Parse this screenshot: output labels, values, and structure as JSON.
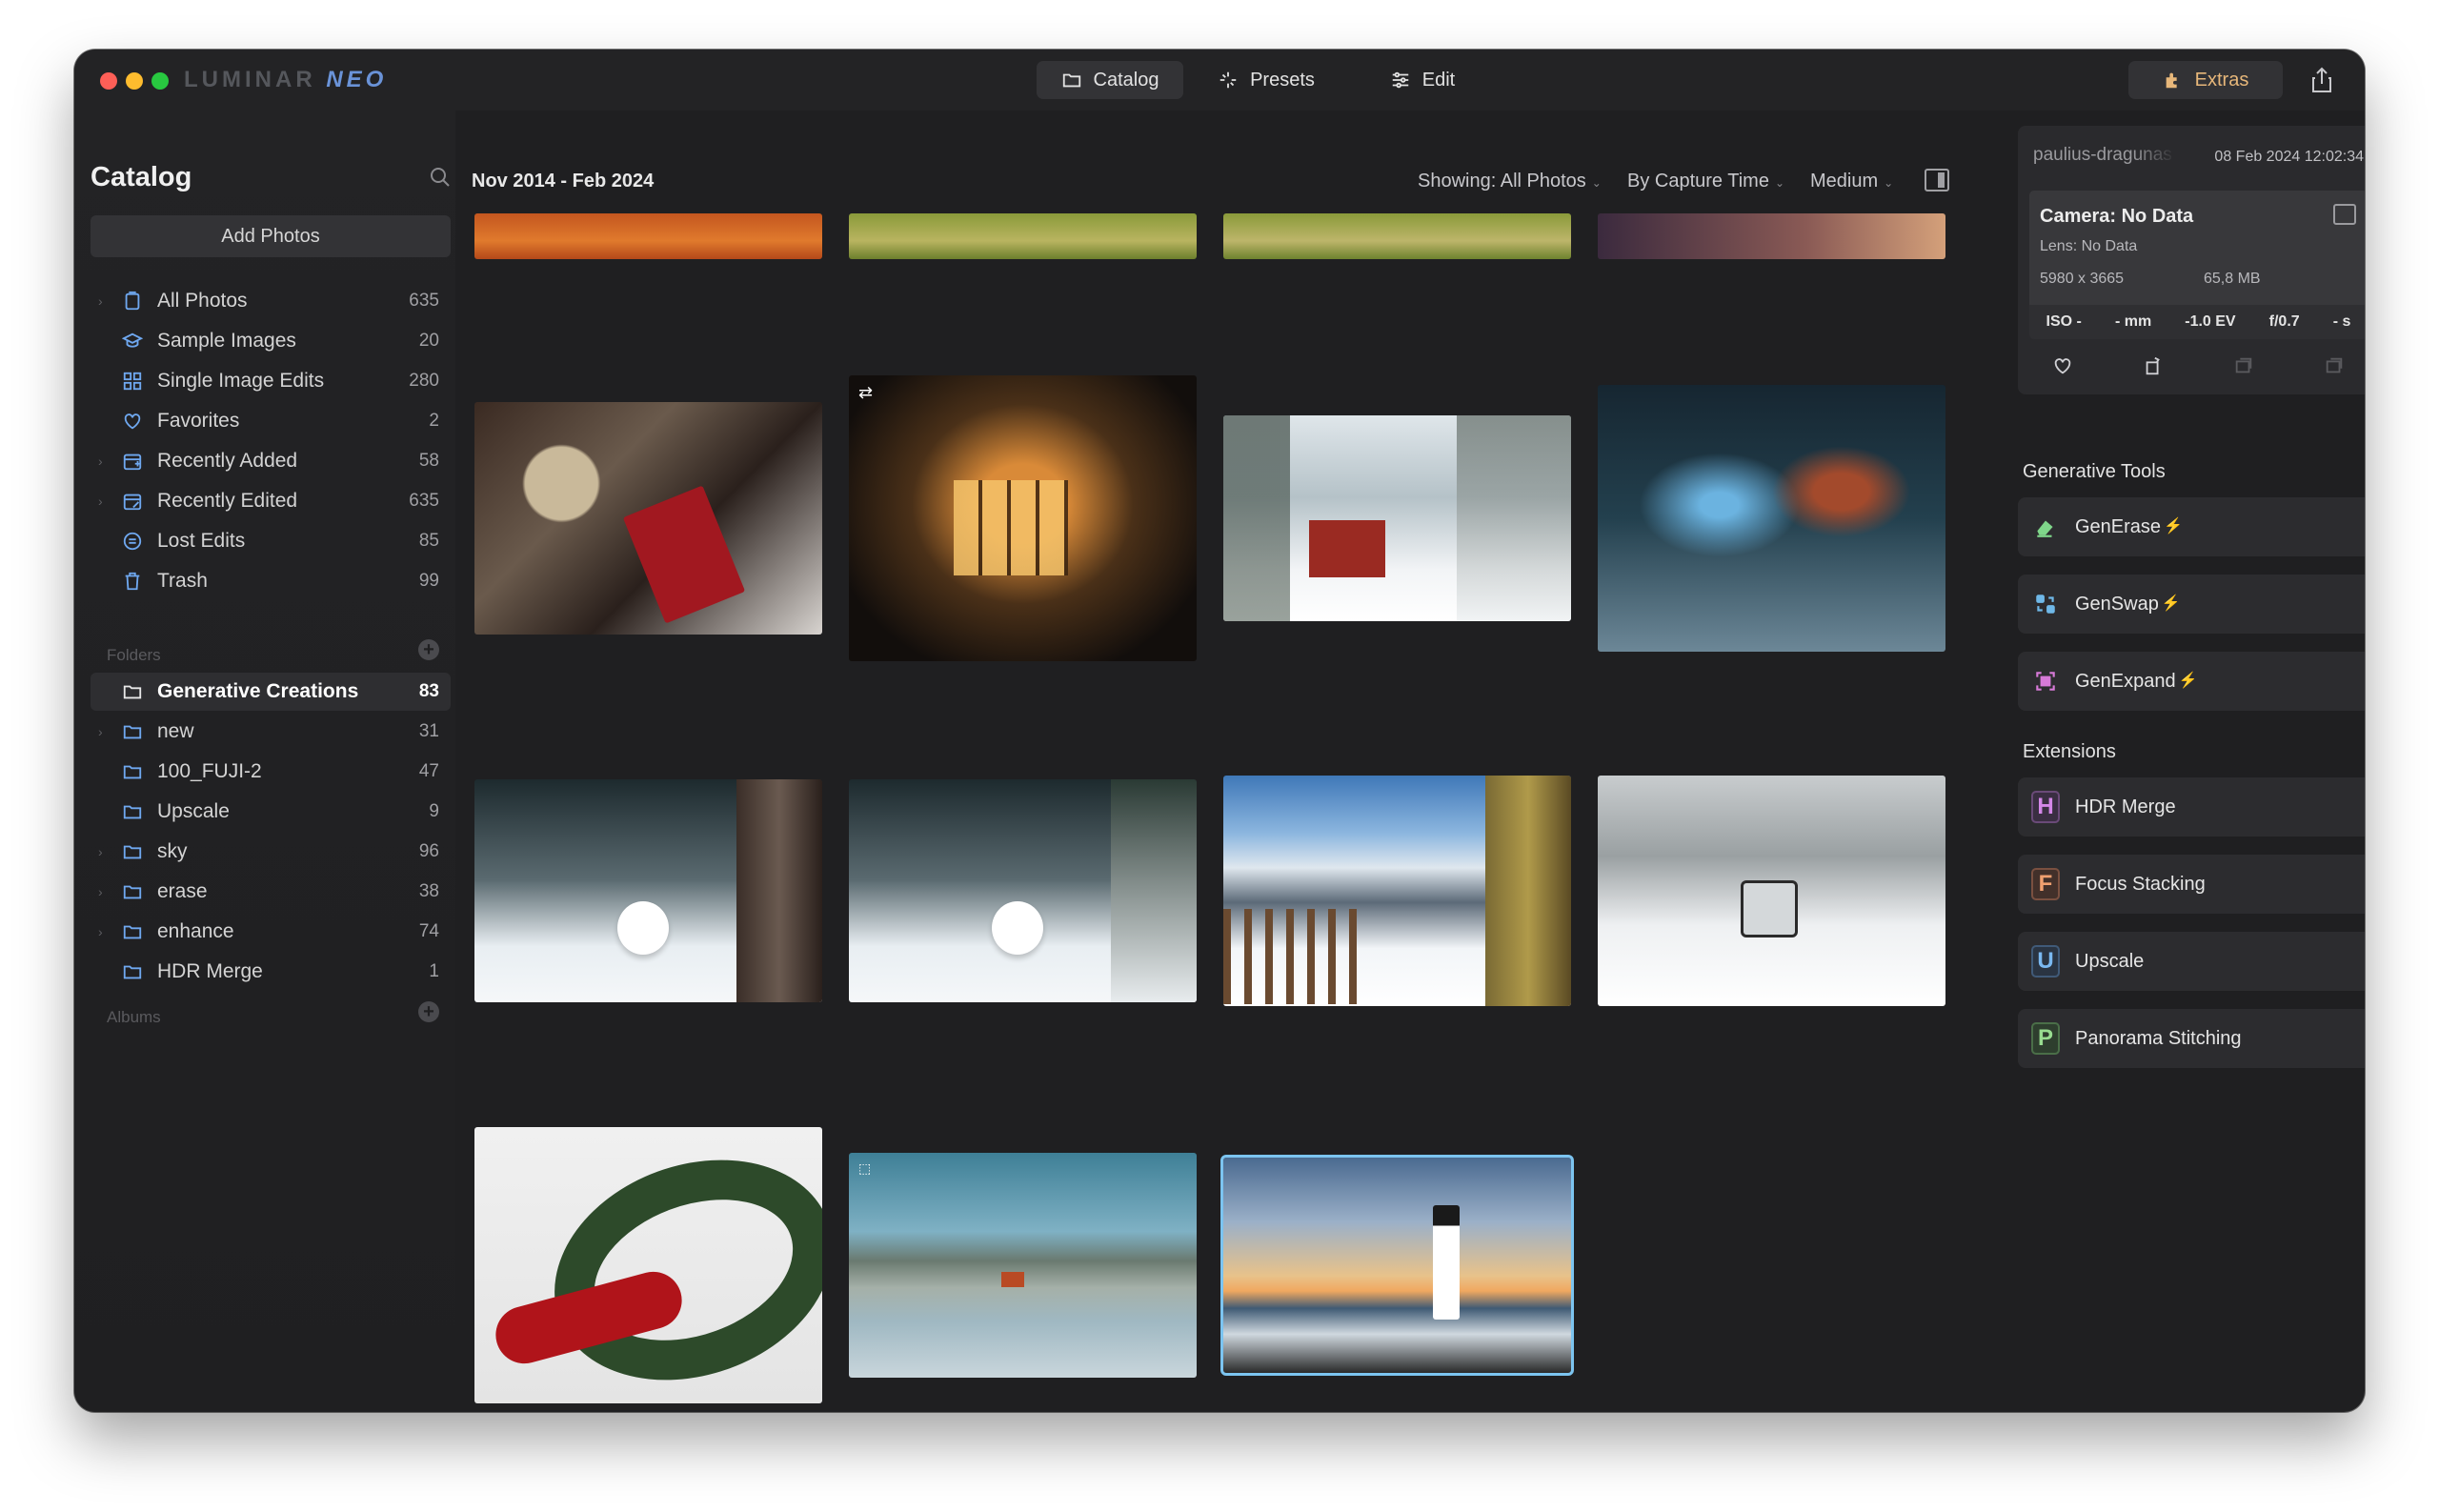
{
  "app": {
    "brand_a": "LUMINAR",
    "brand_b": "NEO"
  },
  "titlebar": {
    "tabs": [
      {
        "label": "Catalog",
        "icon": "folder-icon",
        "active": true
      },
      {
        "label": "Presets",
        "icon": "sparkle-icon",
        "active": false
      },
      {
        "label": "Edit",
        "icon": "sliders-icon",
        "active": false
      }
    ],
    "extras_label": "Extras",
    "share_icon": "share-icon"
  },
  "sidebar": {
    "title": "Catalog",
    "add_photos": "Add Photos",
    "items": [
      {
        "label": "All Photos",
        "count": "635",
        "icon": "photos-icon",
        "color": "#6fa8f0"
      },
      {
        "label": "Sample Images",
        "count": "20",
        "icon": "graduation-cap-icon",
        "color": "#6fa8f0"
      },
      {
        "label": "Single Image Edits",
        "count": "280",
        "icon": "grid-icon",
        "color": "#6fa8f0"
      },
      {
        "label": "Favorites",
        "count": "2",
        "icon": "heart-icon",
        "color": "#6fa8f0"
      },
      {
        "label": "Recently Added",
        "count": "58",
        "icon": "calendar-plus-icon",
        "color": "#6fa8f0"
      },
      {
        "label": "Recently Edited",
        "count": "635",
        "icon": "calendar-edit-icon",
        "color": "#6fa8f0"
      },
      {
        "label": "Lost Edits",
        "count": "85",
        "icon": "lost-edits-icon",
        "color": "#6fa8f0"
      },
      {
        "label": "Trash",
        "count": "99",
        "icon": "trash-icon",
        "color": "#6fa8f0"
      }
    ],
    "folders_head": "Folders",
    "folders": [
      {
        "label": "Generative Creations",
        "count": "83",
        "selected": true
      },
      {
        "label": "new",
        "count": "31"
      },
      {
        "label": "100_FUJI-2",
        "count": "47"
      },
      {
        "label": "Upscale",
        "count": "9"
      },
      {
        "label": "sky",
        "count": "96"
      },
      {
        "label": "erase",
        "count": "38"
      },
      {
        "label": "enhance",
        "count": "74"
      },
      {
        "label": "HDR Merge",
        "count": "1"
      }
    ],
    "albums_head": "Albums"
  },
  "main": {
    "date_range": "Nov 2014 - Feb 2024",
    "showing": "Showing: All Photos",
    "sort": "By Capture Time",
    "size": "Medium"
  },
  "info": {
    "user": "paulius-dragunas",
    "datetime": "08 Feb 2024 12:02:34",
    "camera": "Camera: No Data",
    "lens": "Lens: No Data",
    "dimensions": "5980 x 3665",
    "filesize": "65,8 MB",
    "exif": [
      "ISO -",
      "- mm",
      "-1.0 EV",
      "f/0.7",
      "- s"
    ]
  },
  "generative": {
    "heading": "Generative Tools",
    "tools": [
      {
        "label": "GenErase",
        "icon": "eraser-icon"
      },
      {
        "label": "GenSwap",
        "icon": "genswap-icon"
      },
      {
        "label": "GenExpand",
        "icon": "genexpand-icon"
      }
    ]
  },
  "extensions": {
    "heading": "Extensions",
    "items": [
      {
        "label": "HDR Merge",
        "letter": "H",
        "color": "#c77ad8"
      },
      {
        "label": "Focus Stacking",
        "letter": "F",
        "color": "#e89a6a"
      },
      {
        "label": "Upscale",
        "letter": "U",
        "color": "#6fa8f0"
      },
      {
        "label": "Panorama Stitching",
        "letter": "P",
        "color": "#8fd08a"
      }
    ]
  },
  "photos": [
    {
      "name": "photo-desert-top",
      "desc": "orange desert"
    },
    {
      "name": "photo-field-top-1",
      "desc": "green field"
    },
    {
      "name": "photo-field-top-2",
      "desc": "green field"
    },
    {
      "name": "photo-sunset-top",
      "desc": "purple sunset"
    },
    {
      "name": "photo-cozy-book",
      "desc": "book with candle"
    },
    {
      "name": "photo-shop-window",
      "desc": "shop window night"
    },
    {
      "name": "photo-red-cabin",
      "desc": "red cabin snow"
    },
    {
      "name": "photo-night-street",
      "desc": "snowy street night"
    },
    {
      "name": "photo-dog-snow-1",
      "desc": "white dog snow"
    },
    {
      "name": "photo-dog-snow-2",
      "desc": "white dog snow"
    },
    {
      "name": "photo-mountain-fence",
      "desc": "mountain path"
    },
    {
      "name": "photo-jeep-snow",
      "desc": "jeep in snow"
    },
    {
      "name": "photo-wreath",
      "desc": "christmas wreath"
    },
    {
      "name": "photo-lake-house",
      "desc": "lake house"
    },
    {
      "name": "photo-lighthouse",
      "desc": "lighthouse"
    }
  ]
}
